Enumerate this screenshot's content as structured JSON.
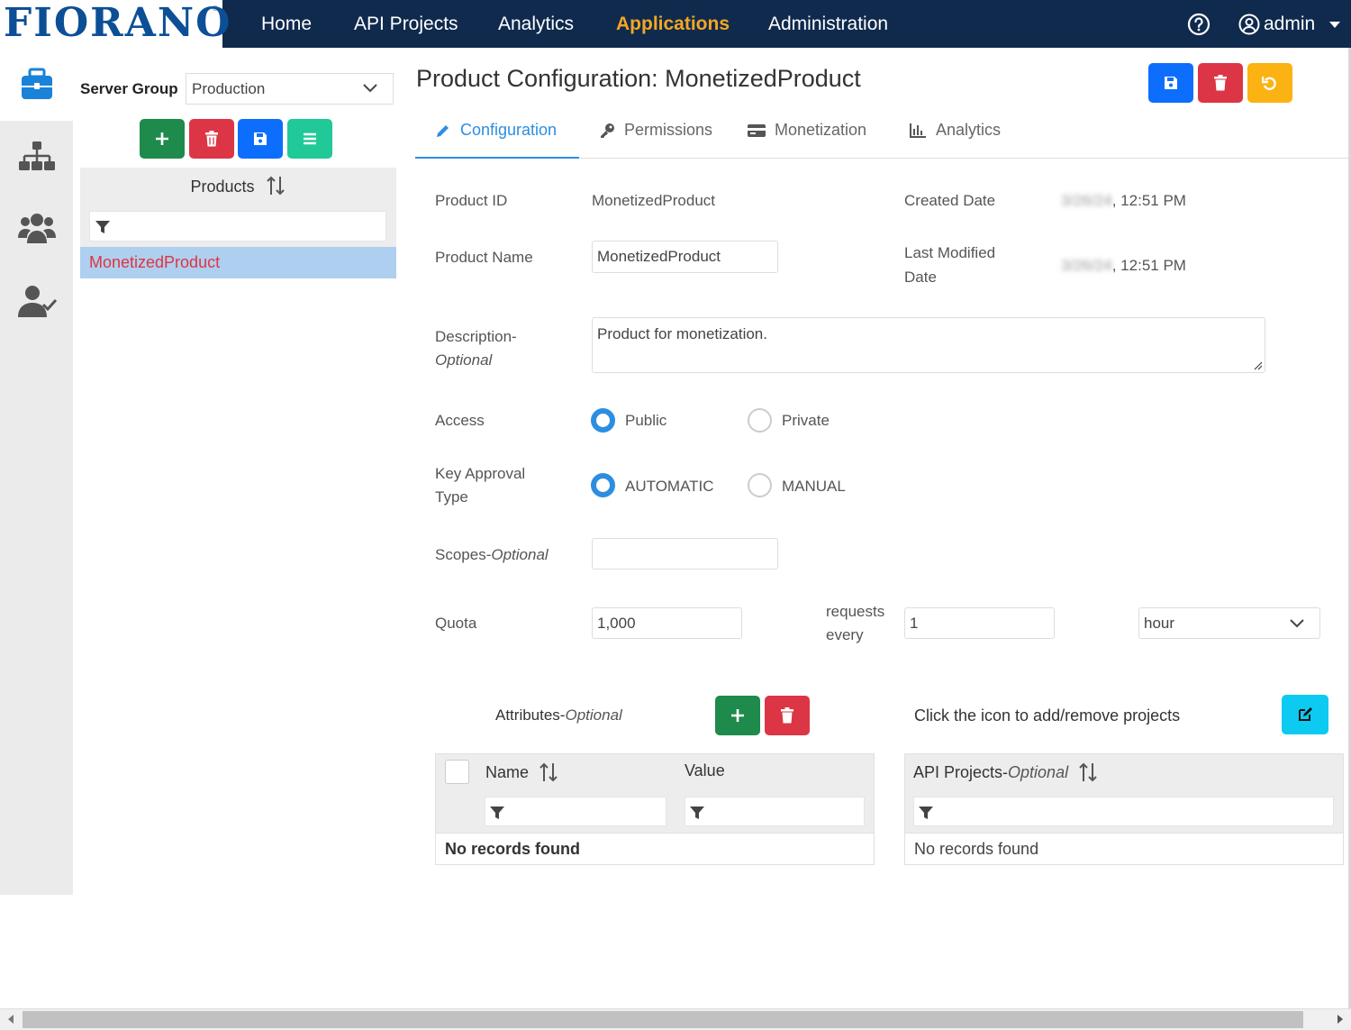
{
  "brand": {
    "logo_text": "FIORANO"
  },
  "nav": {
    "items": [
      {
        "label": "Home"
      },
      {
        "label": "API Projects"
      },
      {
        "label": "Analytics"
      },
      {
        "label": "Applications"
      },
      {
        "label": "Administration"
      }
    ],
    "active": "Applications",
    "user": "admin"
  },
  "left_panel": {
    "server_group_label": "Server Group",
    "server_group_value": "Production",
    "products_header": "Products",
    "products": [
      {
        "name": "MonetizedProduct",
        "selected": true
      }
    ]
  },
  "page": {
    "title": "Product Configuration: MonetizedProduct",
    "tabs": [
      {
        "label": "Configuration",
        "icon": "pencil-icon",
        "active": true
      },
      {
        "label": "Permissions",
        "icon": "key-icon"
      },
      {
        "label": "Monetization",
        "icon": "credit-card-icon"
      },
      {
        "label": "Analytics",
        "icon": "chart-icon"
      }
    ]
  },
  "form": {
    "product_id_label": "Product ID",
    "product_id_value": "MonetizedProduct",
    "created_date_label": "Created Date",
    "created_date_blurred": "3/26/24",
    "created_time": ", 12:51 PM",
    "product_name_label": "Product Name",
    "product_name_value": "MonetizedProduct",
    "last_modified_label_1": "Last Modified",
    "last_modified_label_2": "Date",
    "last_modified_blurred": "3/26/24",
    "last_modified_time": ", 12:51 PM",
    "description_label_1": "Description-",
    "description_label_2": "Optional",
    "description_value": "Product for monetization.",
    "access_label": "Access",
    "access_options": [
      "Public",
      "Private"
    ],
    "access_selected": "Public",
    "key_approval_label_1": "Key Approval",
    "key_approval_label_2": "Type",
    "key_approval_options": [
      "AUTOMATIC",
      "MANUAL"
    ],
    "key_approval_selected": "AUTOMATIC",
    "scopes_label": "Scopes-",
    "scopes_label_opt": "Optional",
    "scopes_value": "",
    "quota_label": "Quota",
    "quota_value": "1,000",
    "requests_every_1": "requests",
    "requests_every_2": "every",
    "interval_value": "1",
    "interval_unit": "hour"
  },
  "attributes": {
    "label": "Attributes-",
    "label_opt": "Optional",
    "col_name": "Name",
    "col_value": "Value",
    "empty": "No records found"
  },
  "projects": {
    "hint": "Click the icon to add/remove projects",
    "col": "API Projects-",
    "col_opt": "Optional",
    "empty": "No records found"
  },
  "colors": {
    "topbar": "#0f2a4d",
    "accent": "#2d8ee0",
    "nav_active": "#f5a623",
    "success": "#1e8a4c",
    "danger": "#dc3545",
    "primary": "#0d6efd",
    "warning": "#fbb213"
  }
}
